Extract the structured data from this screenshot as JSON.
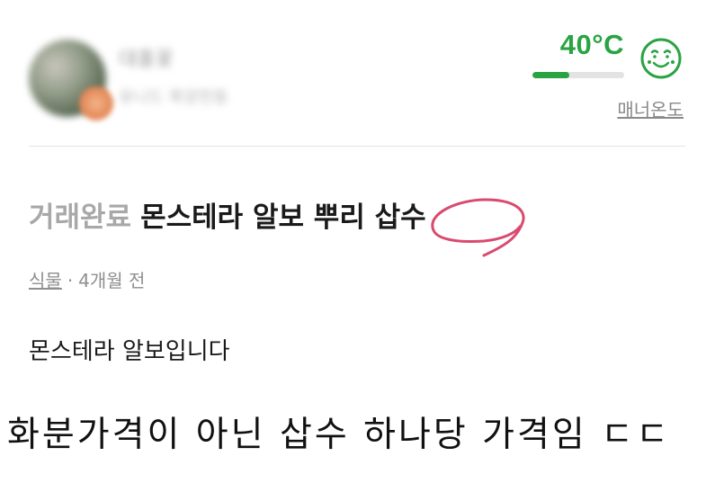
{
  "profile": {
    "nickname": "대홍꽃",
    "location": "유니드 목양천동",
    "temperature": "40°C",
    "temperature_level_percent": 40,
    "manner_label": "매너온도",
    "accent_color": "#2aa343"
  },
  "post": {
    "status": "거래완료",
    "title": "몬스테라 알보 뿌리 삽수",
    "category": "식물",
    "separator": "·",
    "time_ago": "4개월 전",
    "body": "몬스테라 알보입니다"
  },
  "annotation": {
    "circled_text": "삽수",
    "color": "#d94a6f"
  },
  "caption": {
    "text": "화분가격이 아닌 삽수 하나당 가격임 ㄷㄷ"
  },
  "icons": {
    "manner_face": "smiling-face-icon"
  }
}
